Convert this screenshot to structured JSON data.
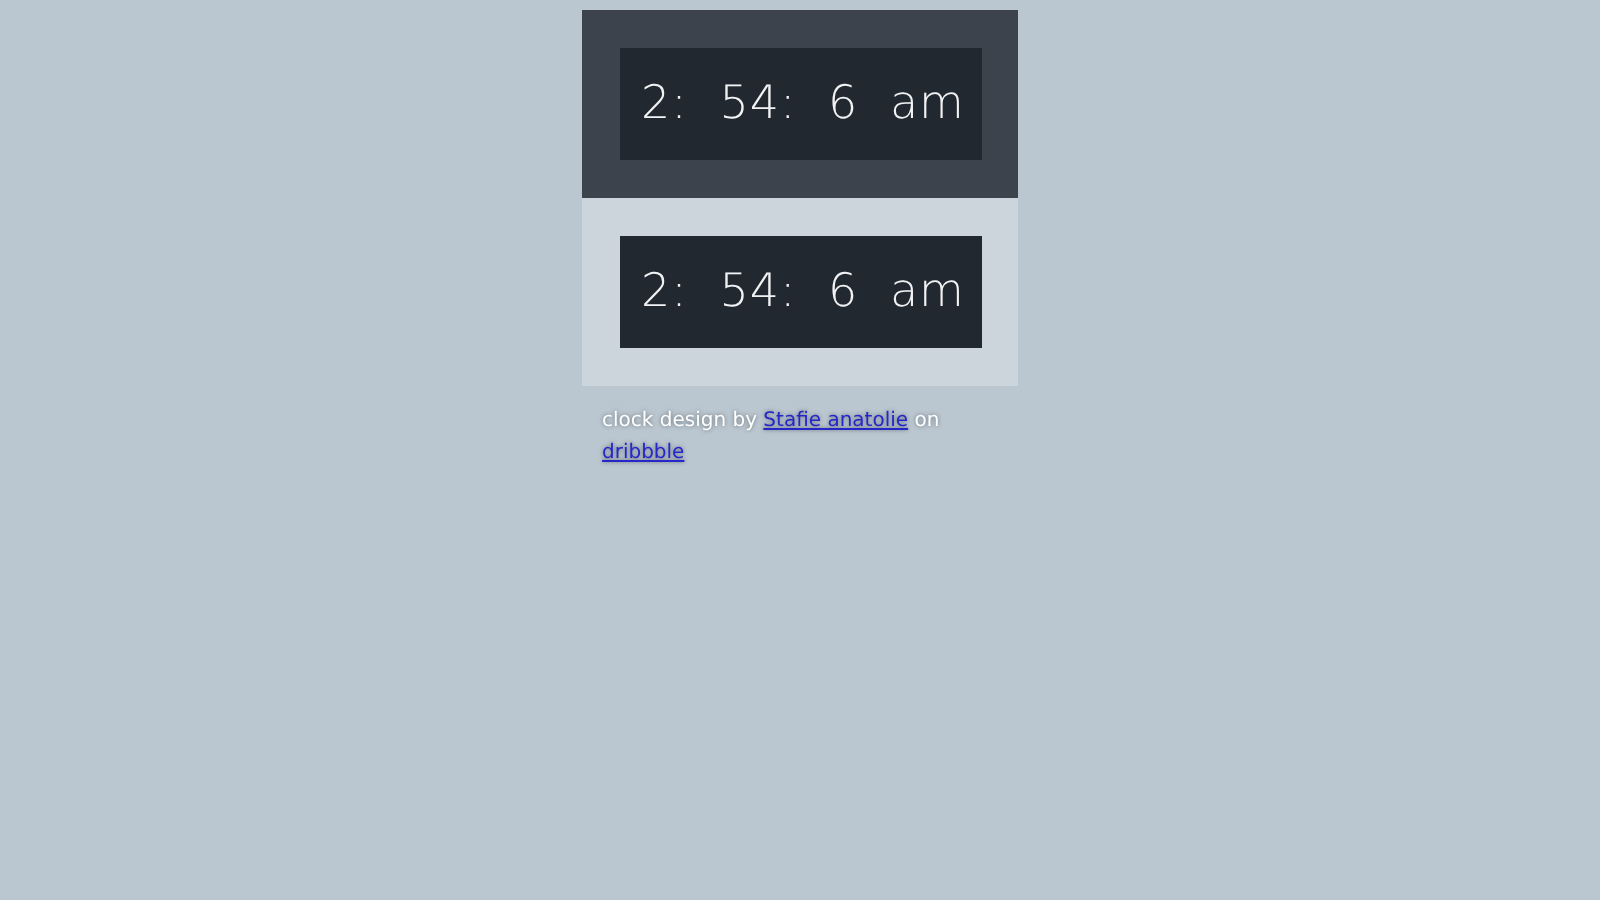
{
  "clocks": [
    {
      "kind": "dark",
      "time": "2: 54: 6 am"
    },
    {
      "kind": "light",
      "time": "2: 54: 6 am"
    }
  ],
  "credit": [
    {
      "kind": "text",
      "text": "clock design by "
    },
    {
      "kind": "link",
      "text": "Stafie anatolie"
    },
    {
      "kind": "text",
      "text": " on "
    },
    {
      "kind": "link",
      "text": "dribbble"
    }
  ]
}
